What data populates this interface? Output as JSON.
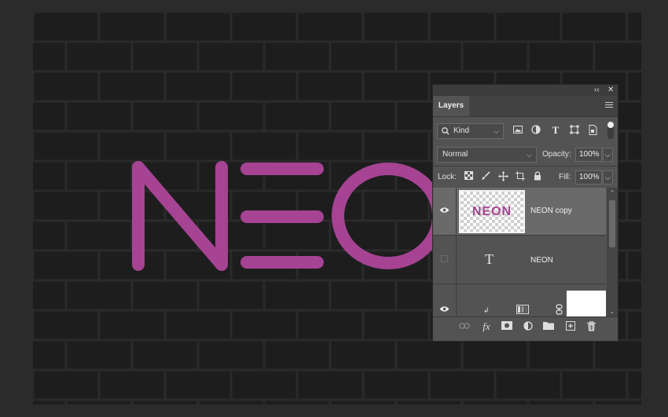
{
  "canvas": {
    "neon_text": "NEON",
    "neon_color": "#a64393",
    "wall_color": "#1d1d1e",
    "mortar_color": "#2a2a2b"
  },
  "panel": {
    "collapse_icon": "double-chevron-left-icon",
    "close_icon": "close-icon",
    "tab_label": "Layers",
    "filter_kind": "Kind",
    "filter_icons": [
      "image-filter-icon",
      "adjustment-filter-icon",
      "type-filter-icon",
      "shape-filter-icon",
      "smart-object-filter-icon"
    ],
    "blend_mode": "Normal",
    "opacity_label": "Opacity:",
    "opacity_value": "100%",
    "lock_label": "Lock:",
    "fill_label": "Fill:",
    "fill_value": "100%",
    "layers": [
      {
        "name": "NEON copy",
        "visible": true,
        "selected": true,
        "thumb_text": "NEON",
        "type": "rasterized"
      },
      {
        "name": "NEON",
        "visible": false,
        "selected": false,
        "type": "text",
        "glyph": "T"
      },
      {
        "name": "",
        "visible": true,
        "selected": false,
        "type": "gradient-map"
      }
    ],
    "bottom_icons": [
      "link-layers-icon",
      "fx-icon",
      "mask-icon",
      "adjustment-icon",
      "group-folder-icon",
      "new-layer-icon",
      "trash-icon"
    ],
    "fx_label": "fx"
  }
}
